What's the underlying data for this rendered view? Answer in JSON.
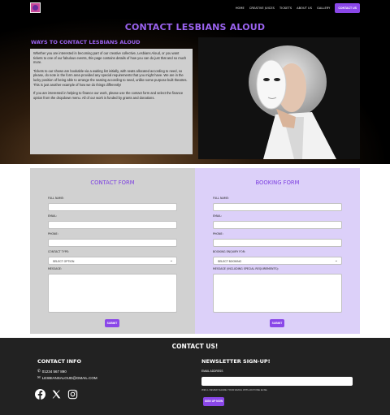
{
  "nav": {
    "logo_icon": "logo-icon",
    "links": [
      "Home",
      "Creative Juices",
      "Tickets",
      "About Us",
      "Gallery"
    ],
    "cta": "Contact Us"
  },
  "hero": {
    "title": "CONTACT LESBIANS ALOUD",
    "subtitle": "WAYS TO CONTACT LESBIANS ALOUD",
    "paragraphs": [
      "Whether you are interested in becoming part of our creative collective, Lesbians Aloud, or you want tickets to one of our fabulous events, this page contains details of how you can do just that and so much more.",
      "Tickets to our shows are bookable via a waiting list initially, with seats allocated according to need, so please, do note in the form area provided any special requirements that you might have. We are in the lucky position of being able to arrange the seating according to need, unlike some purpose built theatres. This is just another example of how we do things differently!",
      "If you are interested in helping to finance our work, please use the contact form and select the finance option from the dropdown menu. All of our work is funded by grants and donations."
    ]
  },
  "contact_form": {
    "title": "CONTACT FORM",
    "full_name_label": "Full Name:",
    "email_label": "Email:",
    "phone_label": "Phone:",
    "contact_type_label": "Contact Type:",
    "contact_type_value": "Select Option",
    "message_label": "Message:",
    "submit": "Submit"
  },
  "booking_form": {
    "title": "BOOKING FORM",
    "full_name_label": "Full Name:",
    "email_label": "Email:",
    "phone_label": "Phone:",
    "booking_label": "Booking Enquiry For:",
    "booking_value": "Select Booking",
    "message_label": "Message (Including Special Requirements):",
    "submit": "Submit"
  },
  "footer": {
    "title": "CONTACT US!",
    "info_heading": "CONTACT INFO",
    "phone": "01234 567 890",
    "email": "LESBIANSALOUD@GMAIL.COM",
    "socials": [
      "facebook-icon",
      "x-icon",
      "instagram-icon"
    ],
    "newsletter_heading": "NEWSLETTER SIGN-UP!",
    "email_label": "Email Address",
    "email_note": "We'll never share your email with anyone else.",
    "signup": "Sign Up Now"
  },
  "colors": {
    "accent": "#8a47e8",
    "heading_purple": "#9b63f0",
    "contact_panel": "#d1d1d1",
    "booking_panel": "#dcd0f9",
    "footer_bg": "#222222"
  }
}
